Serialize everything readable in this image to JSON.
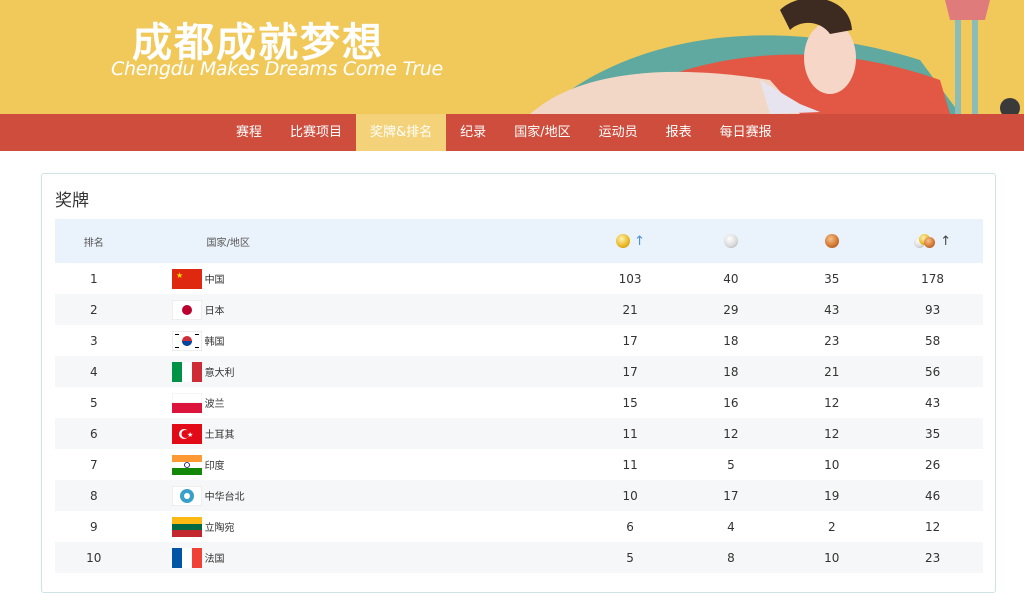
{
  "banner": {
    "title": "成都成就梦想",
    "subtitle": "Chengdu Makes Dreams Come True"
  },
  "nav": {
    "items": [
      {
        "label": "赛程"
      },
      {
        "label": "比赛项目"
      },
      {
        "label": "奖牌&排名"
      },
      {
        "label": "纪录"
      },
      {
        "label": "国家/地区"
      },
      {
        "label": "运动员"
      },
      {
        "label": "报表"
      },
      {
        "label": "每日赛报"
      }
    ],
    "active_index": 2
  },
  "panel": {
    "title": "奖牌"
  },
  "table": {
    "headers": {
      "rank": "排名",
      "country": "国家/地区",
      "gold_icon": "gold-medal-icon",
      "silver_icon": "silver-medal-icon",
      "bronze_icon": "bronze-medal-icon",
      "total_icon": "total-medals-icon",
      "sort_arrow": "↑"
    },
    "rows": [
      {
        "rank": "1",
        "country": "中国",
        "flag": "china-flag-icon",
        "gold": "103",
        "silver": "40",
        "bronze": "35",
        "total": "178"
      },
      {
        "rank": "2",
        "country": "日本",
        "flag": "japan-flag-icon",
        "gold": "21",
        "silver": "29",
        "bronze": "43",
        "total": "93"
      },
      {
        "rank": "3",
        "country": "韩国",
        "flag": "korea-flag-icon",
        "gold": "17",
        "silver": "18",
        "bronze": "23",
        "total": "58"
      },
      {
        "rank": "4",
        "country": "意大利",
        "flag": "italy-flag-icon",
        "gold": "17",
        "silver": "18",
        "bronze": "21",
        "total": "56"
      },
      {
        "rank": "5",
        "country": "波兰",
        "flag": "poland-flag-icon",
        "gold": "15",
        "silver": "16",
        "bronze": "12",
        "total": "43"
      },
      {
        "rank": "6",
        "country": "土耳其",
        "flag": "turkey-flag-icon",
        "gold": "11",
        "silver": "12",
        "bronze": "12",
        "total": "35"
      },
      {
        "rank": "7",
        "country": "印度",
        "flag": "india-flag-icon",
        "gold": "11",
        "silver": "5",
        "bronze": "10",
        "total": "26"
      },
      {
        "rank": "8",
        "country": "中华台北",
        "flag": "chinese-taipei-flag-icon",
        "gold": "10",
        "silver": "17",
        "bronze": "19",
        "total": "46"
      },
      {
        "rank": "9",
        "country": "立陶宛",
        "flag": "lithuania-flag-icon",
        "gold": "6",
        "silver": "4",
        "bronze": "2",
        "total": "12"
      },
      {
        "rank": "10",
        "country": "法国",
        "flag": "france-flag-icon",
        "gold": "5",
        "silver": "8",
        "bronze": "10",
        "total": "23"
      }
    ]
  },
  "colors": {
    "banner_bg": "#f0c95a",
    "nav_bg": "#cf4d3c",
    "nav_active_bg": "#f3d27a",
    "header_bg": "#eaf2fb",
    "panel_border": "#cde3e6"
  }
}
